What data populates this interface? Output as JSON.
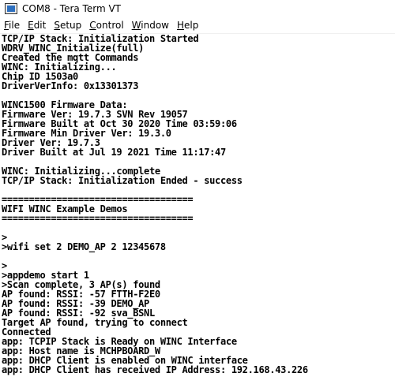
{
  "window": {
    "title": "COM8 - Tera Term VT"
  },
  "menu": [
    {
      "label": "File",
      "accel": "F",
      "rest": "ile"
    },
    {
      "label": "Edit",
      "accel": "E",
      "rest": "dit"
    },
    {
      "label": "Setup",
      "accel": "S",
      "rest": "etup"
    },
    {
      "label": "Control",
      "accel": "C",
      "rest": "ontrol"
    },
    {
      "label": "Window",
      "accel": "W",
      "rest": "indow"
    },
    {
      "label": "Help",
      "accel": "H",
      "rest": "elp"
    }
  ],
  "terminal": {
    "lines": [
      "TCP/IP Stack: Initialization Started",
      "WDRV_WINC_Initialize(full)",
      "Created the mqtt Commands",
      "WINC: Initializing...",
      "Chip ID 1503a0",
      "DriverVerInfo: 0x13301373",
      "",
      "WINC1500 Firmware Data:",
      "Firmware Ver: 19.7.3 SVN Rev 19057",
      "Firmware Built at Oct 30 2020 Time 03:59:06",
      "Firmware Min Driver Ver: 19.3.0",
      "Driver Ver: 19.7.3",
      "Driver Built at Jul 19 2021 Time 11:17:47",
      "",
      "WINC: Initializing...complete",
      "TCP/IP Stack: Initialization Ended - success",
      "",
      "===================================",
      "WIFI WINC Example Demos",
      "===================================",
      "",
      ">",
      ">wifi set 2 DEMO_AP 2 12345678",
      "",
      ">",
      ">appdemo start 1",
      ">Scan complete, 3 AP(s) found",
      "AP found: RSSI: -57 FTTH-F2E0",
      "AP found: RSSI: -39 DEMO_AP",
      "AP found: RSSI: -92 sva_BSNL",
      "Target AP found, trying to connect",
      "Connected",
      "app: TCPIP Stack is Ready on WINC Interface",
      "app: Host name is MCHPBOARD_W",
      "app: DHCP Client is enabled on WINC interface",
      "app: DHCP Client has received IP Address: 192.168.43.226"
    ]
  }
}
